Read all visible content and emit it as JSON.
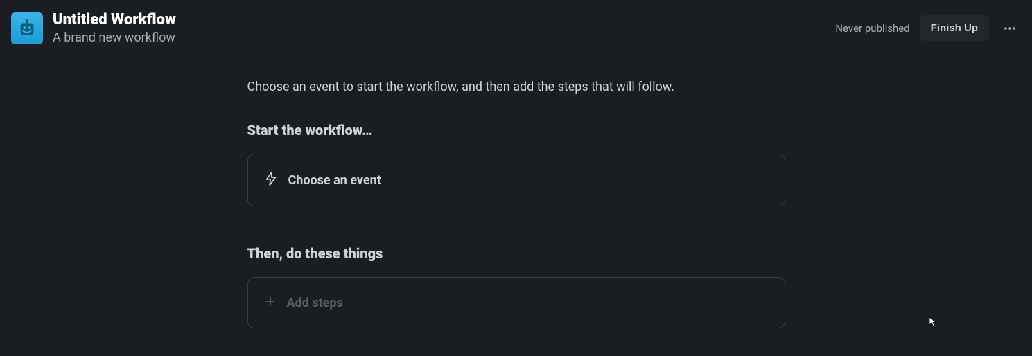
{
  "header": {
    "title": "Untitled Workflow",
    "subtitle": "A brand new workflow",
    "publish_status": "Never published",
    "finish_button": "Finish Up"
  },
  "main": {
    "intro": "Choose an event to start the workflow, and then add the steps that will follow.",
    "start_heading": "Start the workflow…",
    "choose_event_label": "Choose an event",
    "then_heading": "Then, do these things",
    "add_steps_label": "Add steps"
  }
}
